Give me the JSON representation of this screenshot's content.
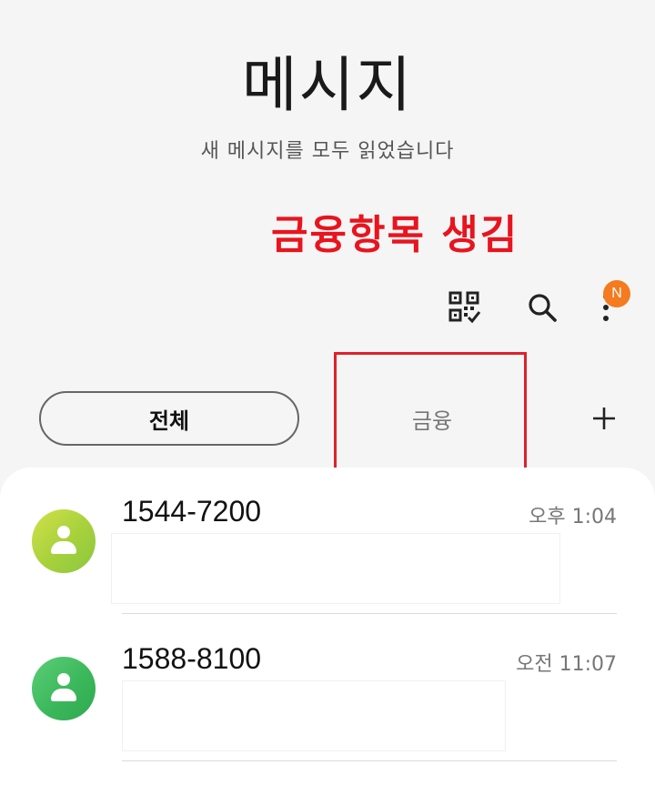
{
  "header": {
    "title": "메시지",
    "subtitle": "새 메시지를 모두 읽었습니다"
  },
  "annotation": {
    "text": "금융항목 생김",
    "color": "#e8141e"
  },
  "toolbar": {
    "qr_icon": "qr-code-icon",
    "search_icon": "search-icon",
    "more_icon": "more-vertical-icon",
    "badge": "N",
    "badge_color": "#f47b20"
  },
  "tabs": [
    {
      "label": "전체",
      "selected": true
    },
    {
      "label": "금융",
      "selected": false
    }
  ],
  "add_tab_icon": "plus-icon",
  "conversations": [
    {
      "sender": "1544-7200",
      "time": "오후 1:04",
      "avatar_colors": [
        "#c8dc3c",
        "#8cc63f"
      ]
    },
    {
      "sender": "1588-8100",
      "time": "오전 11:07",
      "avatar_colors": [
        "#4cc46a",
        "#2fa84f"
      ]
    }
  ]
}
